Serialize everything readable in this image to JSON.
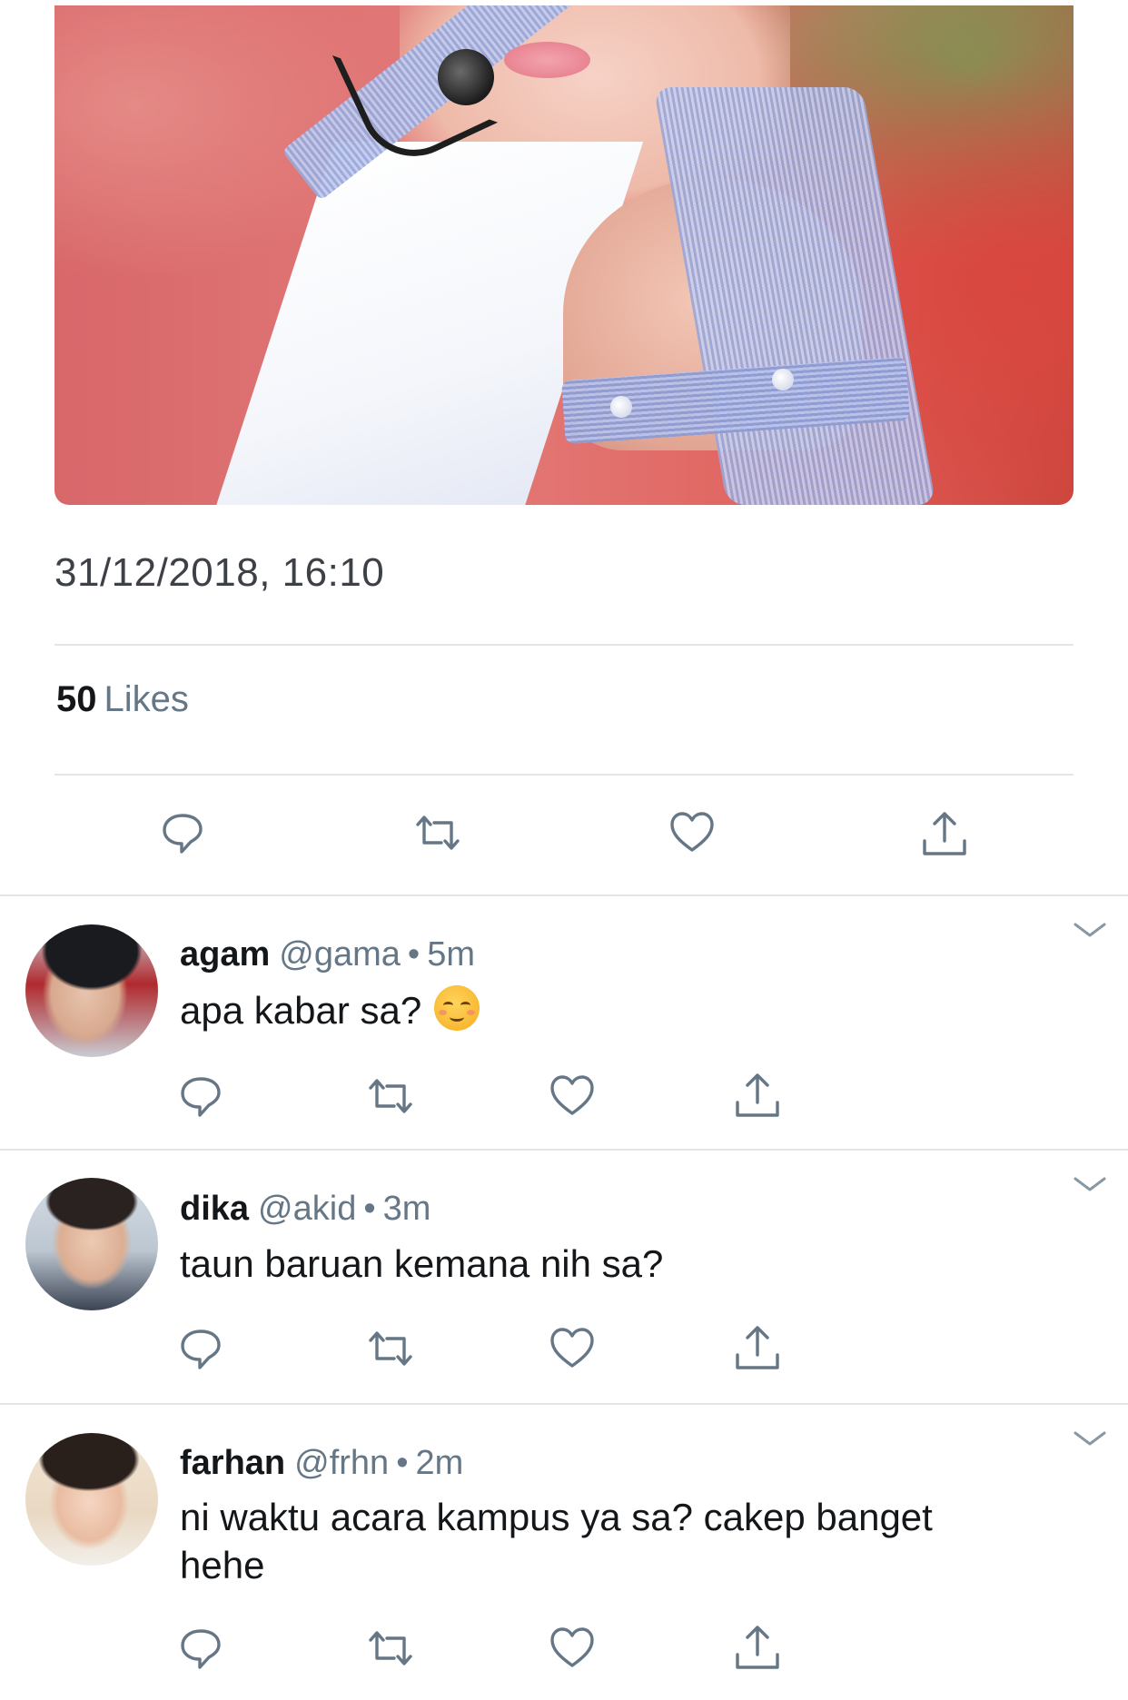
{
  "tweet": {
    "timestamp": "31/12/2018, 16:10",
    "likes_count": "50",
    "likes_label": "Likes"
  },
  "icons": {
    "reply": "reply-icon",
    "retweet": "retweet-icon",
    "like": "heart-icon",
    "share": "share-icon",
    "more": "chevron-down-icon"
  },
  "replies": [
    {
      "name": "agam",
      "handle": "@gama",
      "separator": "•",
      "time": "5m",
      "text": "apa kabar sa?",
      "emoji": "☺️"
    },
    {
      "name": "dika",
      "handle": "@akid",
      "separator": "•",
      "time": "3m",
      "text": "taun baruan kemana nih sa?"
    },
    {
      "name": "farhan",
      "handle": "@frhn",
      "separator": "•",
      "time": "2m",
      "text": "ni waktu acara kampus ya sa? cakep banget hehe"
    }
  ],
  "colors": {
    "text": "#14171a",
    "secondary": "#657786",
    "icon": "#657786",
    "divider": "#e1e6ea"
  }
}
